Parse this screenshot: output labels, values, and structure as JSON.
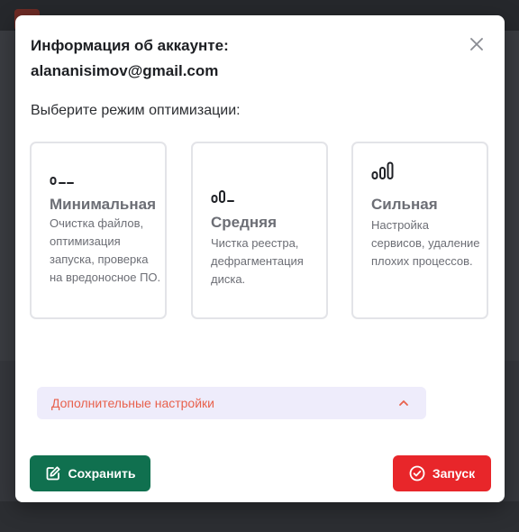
{
  "dialog": {
    "title": "Информация об аккаунте:",
    "email": "alananisimov@gmail.com",
    "subtitle": "Выберите режим оптимизации:"
  },
  "modes": [
    {
      "name": "Минимальная",
      "description": "Очистка файлов, оптимизация запуска, проверка на вредоносное ПО.",
      "icon": "signal-low-icon"
    },
    {
      "name": "Средняя",
      "description": "Чистка реестра, дефрагментация диска.",
      "icon": "signal-medium-icon"
    },
    {
      "name": "Сильная",
      "description": "Настройка сервисов, удаление плохих процессов.",
      "icon": "signal-high-icon"
    }
  ],
  "advanced": {
    "label": "Дополнительные настройки",
    "expanded": true
  },
  "actions": {
    "save_label": "Сохранить",
    "run_label": "Запуск"
  },
  "colors": {
    "save": "#10704f",
    "run": "#e8262a",
    "advanced_text": "#e8614c",
    "advanced_bg": "#eeecfb"
  }
}
